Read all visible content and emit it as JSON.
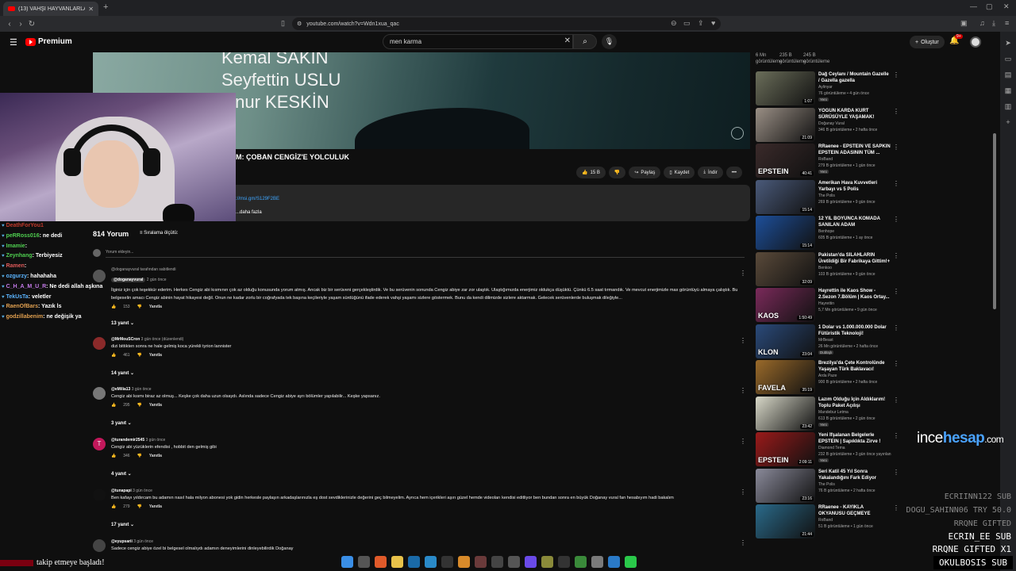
{
  "browser": {
    "tab_title": "(13) VAHŞİ HAYVANLARLA ARKA",
    "new_tab": "+",
    "url": "youtube.com/watch?v=Wdn1xua_qac"
  },
  "yt": {
    "logo": "Premium",
    "search_value": "men karma",
    "create_label": "Oluştur",
    "notif_count": "9+"
  },
  "video": {
    "credits": [
      "Kemal SAKIN",
      "Seyfettin USLU",
      "Onur KESKİN"
    ],
    "title": "M: ÇOBAN CENGİZ'E YOLCULUK",
    "like_count": "15 B",
    "share": "Paylaş",
    "save": "Kaydet",
    "download": "İndir",
    "desc_link": "://msi.gm/S129F2BE",
    "desc_more": "...daha fazla"
  },
  "chat": [
    {
      "user": "DeathForYou1",
      "msg": "",
      "color": "#c0392b"
    },
    {
      "user": "peRRoss016",
      "msg": ": ne dedi",
      "color": "#4fcf50"
    },
    {
      "user": "Imamie",
      "msg": ": ",
      "color": "#4fcf50"
    },
    {
      "user": "Zeynhang",
      "msg": ": Terbiyesiz",
      "color": "#4fcf50"
    },
    {
      "user": "Ramen",
      "msg": ": ",
      "color": "#e05a5a"
    },
    {
      "user": "ozgurzy",
      "msg": ": hahahaha",
      "color": "#5ab4ff"
    },
    {
      "user": "C_H_A_M_U_R",
      "msg": ": Ne dedi allah aşkına",
      "color": "#c47ae8"
    },
    {
      "user": "TekUsTa",
      "msg": ": veletler",
      "color": "#5ab4ff"
    },
    {
      "user": "RaenOfBars",
      "msg": ": Yazık ls",
      "color": "#e0a050"
    },
    {
      "user": "godzillabenim",
      "msg": ": ne değişik ya",
      "color": "#e0a050"
    }
  ],
  "comments": {
    "count": "814 Yorum",
    "sort": "Sıralama ölçütü:",
    "add_placeholder": "Yorum ekleyin...",
    "pinned_note": "@doganayvural tarafından sabitlendi",
    "items": [
      {
        "author": "@doganayvural",
        "time": "2 gün önce",
        "text": "İlginiz için çok teşekkür ederim. Herkes Cengiz abi kısmının çok az olduğu konusunda yorum atmış. Ancak biz bir serüveni gerçekleştirdik. Ve bu serüvenin sonunda Cengiz abiye zar zor ulaştık. Ulaştığımızda enerjimiz oldukça düşüktü. Çünkü 6.5 saat tırmandık. Ve mevcut enerjimizle max görüntüyü almaya çalıştık. Bu belgeselin amacı Cengiz abinin hayat hikayesi değil. Onun ne kadar zorlu bir coğrafyada tek başına keçileriyle yaşam sürdüğünü ifade ederek vahşi yaşamı sizlere göstermek. Bunu da kendi dilimizde sizlere aktarmak. Gelecek serüvenlerde buluşmak dileğiyle...",
        "likes": "153",
        "reply": "Yanıtla",
        "replies": "13 yanıt",
        "color": "#555"
      },
      {
        "author": "@MrMouSCron",
        "time": "3 gün önce (düzenlendi)",
        "text": "dizi bittikten sonra ne hale gelmiş koca yürekli tyrion lannister",
        "likes": "461",
        "reply": "Yanıtla",
        "replies": "14 yanıt",
        "color": "#8b2a2a"
      },
      {
        "author": "@eMilia13",
        "time": "3 gün önce",
        "text": "Cengiz abi kısmı biraz az olmuş... Keşke çok daha uzun olsaydı. Aslında sadece Cengiz abiye ayrı bölümler yapılabilir... Keşke yapsanız.",
        "likes": "295",
        "reply": "Yanıtla",
        "replies": "3 yanıt",
        "color": "#777"
      },
      {
        "author": "@turandemir2545",
        "time": "3 gün önce",
        "text": "Cengiz abi yüzüklerin efendisi , hobbit den gelmiş gibi",
        "likes": "346",
        "reply": "Yanıtla",
        "replies": "4 yanıt",
        "color": "#c2185b",
        "initial": "T"
      },
      {
        "author": "@tunapapi",
        "time": "3 gün önce",
        "text": "Ben kafayı yıldırcam bu adamın nasıl hala milyon abonesi yok gidin herkesle paylaşın arkadaşlarınızla eş dost sevdiklerinizle değerini geç bilmeyelim. Ayrıca hem içerikleri aşırı güzel hemde videoları kendisi editliyor ben bundan sonra en büyük Doğanay vural fan hesabıyım hadi bakalım",
        "likes": "279",
        "reply": "Yanıtla",
        "replies": "17 yanıt",
        "color": "#111"
      },
      {
        "author": "@eyupsarii",
        "time": "3 gün önce",
        "text": "Sadece cengiz abiye özel bi belgesel olmalıydı adamın deneyimlerini dinleyebilirdik Doğanay",
        "likes": "",
        "reply": "",
        "replies": "",
        "color": "#444"
      }
    ]
  },
  "right_stats": [
    {
      "value": "6 Mn",
      "label": "görüntüleme"
    },
    {
      "value": "235 B",
      "label": "görüntüleme"
    },
    {
      "value": "245 B",
      "label": "görüntüleme"
    }
  ],
  "recommendations": [
    {
      "title": "Dağ Ceylanı / Mountain Gazelle / Gazella gazella",
      "channel": "Aylinyar",
      "meta": "76 görüntüleme • 4 gün önce",
      "badge": "Yeni",
      "duration": "1:07",
      "thumb": "#6b6e5a",
      "overlay": ""
    },
    {
      "title": "YOĞUN KARDA KURT SÜRÜSÜYLE YAŞAMAK!",
      "channel": "Doğanay Vural",
      "meta": "346 B görüntüleme • 2 hafta önce",
      "badge": "",
      "duration": "21:09",
      "thumb": "#9a8f85",
      "overlay": ""
    },
    {
      "title": "RRaenee - EPSTEIN VE SAPKIN EPSTEIN ADASININ TÜM ...",
      "channel": "RoBand",
      "meta": "279 B görüntüleme • 1 gün önce",
      "badge": "Yeni",
      "duration": "40:41",
      "thumb": "#3a2a2a",
      "overlay": "EPSTEIN"
    },
    {
      "title": "Amerikan Hava Kuvvetleri Yarbayı vs 5 Polis",
      "channel": "The Polis",
      "meta": "269 B görüntüleme • 9 gün önce",
      "badge": "",
      "duration": "15:14",
      "thumb": "#4a5a7a",
      "overlay": ""
    },
    {
      "title": "12 YIL BOYUNCA KOMADA SANILAN ADAM",
      "channel": "Benhope",
      "meta": "605 B görüntüleme • 1 ay önce",
      "badge": "",
      "duration": "15:14",
      "thumb": "#1d4f9a",
      "overlay": ""
    },
    {
      "title": "Pakistan'da SİLAHLARIN Üretildiği Bir Fabrikaya Gittim!+",
      "channel": "Benkoo",
      "meta": "103 B görüntüleme • 9 gün önce",
      "badge": "",
      "duration": "32:09",
      "thumb": "#5a4a3a",
      "overlay": ""
    },
    {
      "title": "Hayrettin ile Kaos Show - 2.Sezon 7.Bölüm | Kaos Ortay...",
      "channel": "Hayrettin",
      "meta": "5,7 Mn görüntüleme • 9 gün önce",
      "badge": "",
      "duration": "1:50:49",
      "thumb": "#7a2a5a",
      "overlay": "KAOS"
    },
    {
      "title": "1 Dolar vs 1.000.000.000 Dolar Fütüristik Teknoloji!",
      "channel": "MrBeast",
      "meta": "26 Mn görüntüleme • 2 hafta önce",
      "badge": "Dublajlı",
      "duration": "23:04",
      "thumb": "#2a4a7a",
      "overlay": "KLON"
    },
    {
      "title": "Brezilya'da Çete Kontrolünde Yaşayan Türk Baklavacı!",
      "channel": "Arda Paze",
      "meta": "900 B görüntüleme • 2 hafta önce",
      "badge": "",
      "duration": "35:19",
      "thumb": "#9a6a2a",
      "overlay": "FAVELA"
    },
    {
      "title": "Lazım Olduğu İçin Aldıklarım! Toplu Paket Açılışı",
      "channel": "Mandebur Letma",
      "meta": "613 B görüntüleme • 2 gün önce",
      "badge": "Yeni",
      "duration": "23:42",
      "thumb": "#d8d8c8",
      "overlay": ""
    },
    {
      "title": "Yeni İfşalanan Belgelerle EPSTEIN | Sapıklıkta Zirve !",
      "channel": "Diamond Tema",
      "meta": "232 B görüntüleme • 3 gün önce yayınlan",
      "badge": "Yeni",
      "duration": "2:09:11",
      "thumb": "#9a1a1a",
      "overlay": "EPSTEIN"
    },
    {
      "title": "Seri Katil 45 Yıl Sonra Yakalandığını Fark Ediyor",
      "channel": "The Polis",
      "meta": "76 B görüntüleme • 2 hafta önce",
      "badge": "",
      "duration": "23:16",
      "thumb": "#8a8a9a",
      "overlay": ""
    },
    {
      "title": "RRaenee - KAYIKLA OKYANUSU GEÇMEYE ÇALIŞAN ADAM ...",
      "channel": "RoBand",
      "meta": "51 B görüntüleme • 1 gün önce",
      "badge": "",
      "duration": "21:44",
      "thumb": "#2a6a8a",
      "overlay": ""
    }
  ],
  "overlay": {
    "brand_a": "ince",
    "brand_b": "hesap",
    "brand_c": ".com",
    "gifts": [
      "ECRIINN122 SUB",
      "DOGU_SAHINN06 TRY 50.0",
      "RRQNE GIFTED",
      "ECRIN_EE SUB",
      "RRQNE GIFTED X1",
      "OKULBOSIS SUB"
    ],
    "follow_text": "takip etmeye başladı!"
  }
}
